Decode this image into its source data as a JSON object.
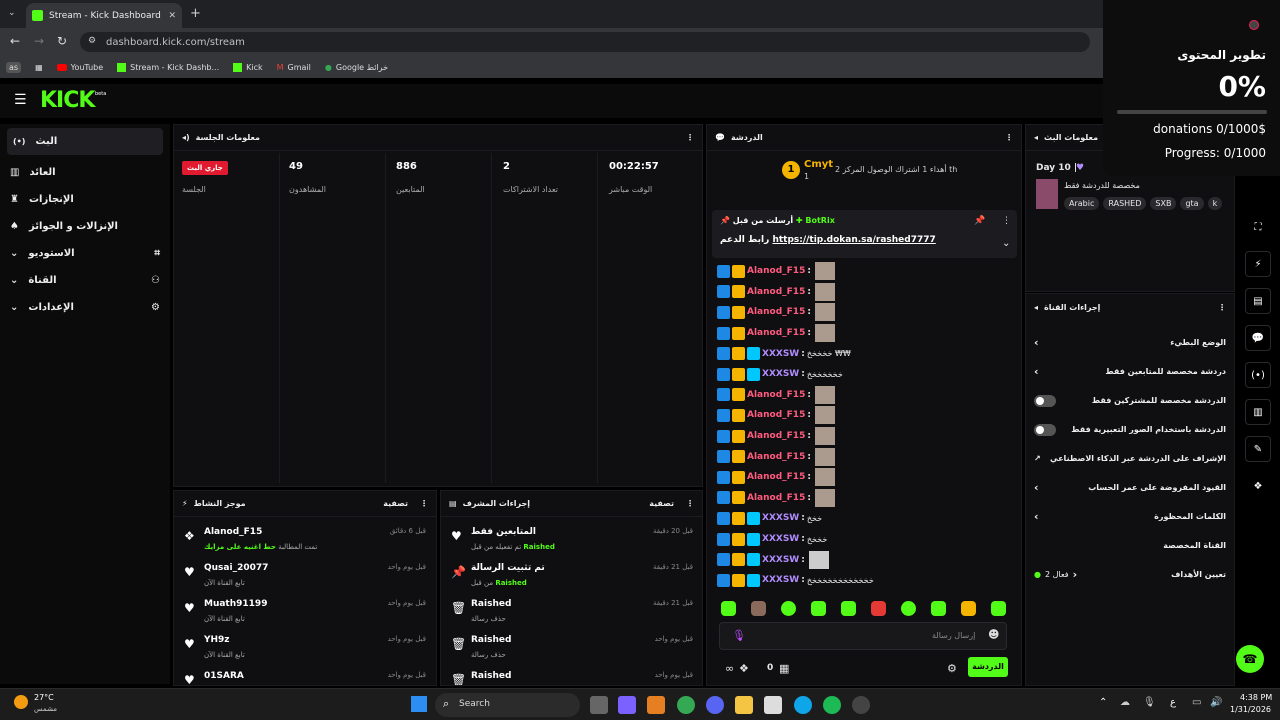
{
  "browser": {
    "tab_title": "Stream - Kick Dashboard",
    "url": "dashboard.kick.com/stream",
    "bookmarks": [
      "YouTube",
      "Stream - Kick Dashb...",
      "Kick",
      "Gmail",
      "Google خرائط"
    ],
    "profile_badge": "as"
  },
  "kick": {
    "logo": "KICK",
    "logo_tag": "beta",
    "sidebar": [
      {
        "label": "البث",
        "icon": "broadcast-icon"
      },
      {
        "label": "العائد",
        "icon": "bank-icon"
      },
      {
        "label": "الإنجازات",
        "icon": "trophy-icon"
      },
      {
        "label": "الإنزالات و الجوائز",
        "icon": "gift-icon"
      },
      {
        "label": "الاستوديو",
        "icon": "studio-icon"
      },
      {
        "label": "القناة",
        "icon": "channel-icon"
      },
      {
        "label": "الإعدادات",
        "icon": "gear-icon"
      }
    ],
    "session": {
      "title": "معلومات الجلسة",
      "live_badge": "جاري البث",
      "stats": [
        {
          "value": "",
          "label": "الجلسة"
        },
        {
          "value": "49",
          "label": "المشاهدون"
        },
        {
          "value": "886",
          "label": "المتابعين"
        },
        {
          "value": "2",
          "label": "تعداد الاشتراكات"
        },
        {
          "value": "00:22:57",
          "label": "الوقت مباشر"
        }
      ]
    },
    "activity": {
      "title": "موجز النشاط",
      "filter": "تصفية",
      "items": [
        {
          "name": "Alanod_F15",
          "sub": "تمت المطالبة",
          "sub_hl": "حط اغنيه على مزايك",
          "time": "قبل 6 دقائق"
        },
        {
          "name": "Qusai_20077",
          "sub": "تابع القناة الآن",
          "sub_hl": "",
          "time": "قبل يوم واحد"
        },
        {
          "name": "Muath91199",
          "sub": "تابع القناة الآن",
          "sub_hl": "",
          "time": "قبل يوم واحد"
        },
        {
          "name": "YH9z",
          "sub": "تابع القناة الآن",
          "sub_hl": "",
          "time": "قبل يوم واحد"
        },
        {
          "name": "01SARA",
          "sub": "",
          "sub_hl": "",
          "time": "قبل يوم واحد"
        }
      ]
    },
    "mod": {
      "title": "إجراءات المشرف",
      "filter": "تصفية",
      "items": [
        {
          "name": "المتابعين فقط",
          "sub": "تم تفعيله من قبل",
          "sub_hl": "Raished",
          "time": "قبل 20 دقيقة"
        },
        {
          "name": "تم تثبيت الرسالة",
          "sub": "من قبل",
          "sub_hl": "Raished",
          "time": "قبل 21 دقيقة"
        },
        {
          "name": "Raished",
          "sub": "حذف رسالة",
          "sub_hl": "",
          "time": "قبل 21 دقيقة"
        },
        {
          "name": "Raished",
          "sub": "حذف رسالة",
          "sub_hl": "",
          "time": "قبل يوم واحد"
        },
        {
          "name": "Raished",
          "sub": "",
          "sub_hl": "",
          "time": "قبل يوم واحد"
        }
      ]
    },
    "chat": {
      "title": "الدردشة",
      "top_user": "Cmyt",
      "top_rank": "1",
      "top_count": "1",
      "top_text": "أهداء 1 اشتراك الوصول المركز 2 th",
      "pinned_by": "أرسلت من قبل",
      "pinned_user": "BotRix",
      "pinned_label": "رابط الدعم",
      "pinned_link": "https://tip.dokan.sa/rashed7777",
      "messages": [
        {
          "user": "Alanod_F15",
          "color": "#ff5b7f",
          "text": ""
        },
        {
          "user": "Alanod_F15",
          "color": "#ff5b7f",
          "text": ""
        },
        {
          "user": "Alanod_F15",
          "color": "#ff5b7f",
          "text": ""
        },
        {
          "user": "Alanod_F15",
          "color": "#ff5b7f",
          "text": ""
        },
        {
          "user": "XXXSW",
          "color": "#b18cff",
          "text": "خخخخخ ₩₩"
        },
        {
          "user": "XXXSW",
          "color": "#b18cff",
          "text": "خخخخخخخ"
        },
        {
          "user": "Alanod_F15",
          "color": "#ff5b7f",
          "text": ""
        },
        {
          "user": "Alanod_F15",
          "color": "#ff5b7f",
          "text": ""
        },
        {
          "user": "Alanod_F15",
          "color": "#ff5b7f",
          "text": ""
        },
        {
          "user": "Alanod_F15",
          "color": "#ff5b7f",
          "text": ""
        },
        {
          "user": "Alanod_F15",
          "color": "#ff5b7f",
          "text": ""
        },
        {
          "user": "Alanod_F15",
          "color": "#ff5b7f",
          "text": ""
        },
        {
          "user": "XXXSW",
          "color": "#b18cff",
          "text": "خخخ"
        },
        {
          "user": "XXXSW",
          "color": "#b18cff",
          "text": "خخخخ"
        },
        {
          "user": "XXXSW",
          "color": "#b18cff",
          "text": ""
        },
        {
          "user": "XXXSW",
          "color": "#b18cff",
          "text": "خخخخخخخخخخخخخ"
        }
      ],
      "input_placeholder": "إرسال رسالة",
      "send_label": "الدردشة",
      "count": "0"
    },
    "stream_info": {
      "title": "معلومات البث",
      "day": "Day 10 |",
      "desc": "مخصصة للدردشة فقط",
      "tags": [
        "Arabic",
        "RASHED",
        "SXB",
        "gta",
        "k"
      ]
    },
    "channel_actions": {
      "title": "إجراءات القناة",
      "items": [
        {
          "label": "الوضع البطيء",
          "ctrl": "arrow"
        },
        {
          "label": "دردشة مخصصة للمتابعين فقط",
          "ctrl": "arrow"
        },
        {
          "label": "الدردشة مخصصة للمشتركين فقط",
          "ctrl": "toggle"
        },
        {
          "label": "الدردشة باستخدام الصور التعبيرية فقط",
          "ctrl": "toggle"
        },
        {
          "label": "الإشراف على الدردشة عبر الذكاء الاصطناعي",
          "ctrl": "external"
        },
        {
          "label": "القيود المفروضة على عمر الحساب",
          "ctrl": "arrow"
        },
        {
          "label": "الكلمات المحظورة",
          "ctrl": "arrow"
        }
      ],
      "custom_section": "القناة المخصصة",
      "goals_label": "تعيين الأهداف",
      "goals_status": "فعال 2"
    },
    "overlay": {
      "title": "تطوير المحتوى",
      "percent": "0%",
      "progress": 0,
      "donations": "donations 0/1000$",
      "progress_text": "Progress: 0/1000"
    }
  },
  "taskbar": {
    "weather_temp": "27°C",
    "weather_desc": "مشمس",
    "search": "Search",
    "time": "4:38 PM",
    "date": "1/31/2026",
    "lang": "ع"
  }
}
